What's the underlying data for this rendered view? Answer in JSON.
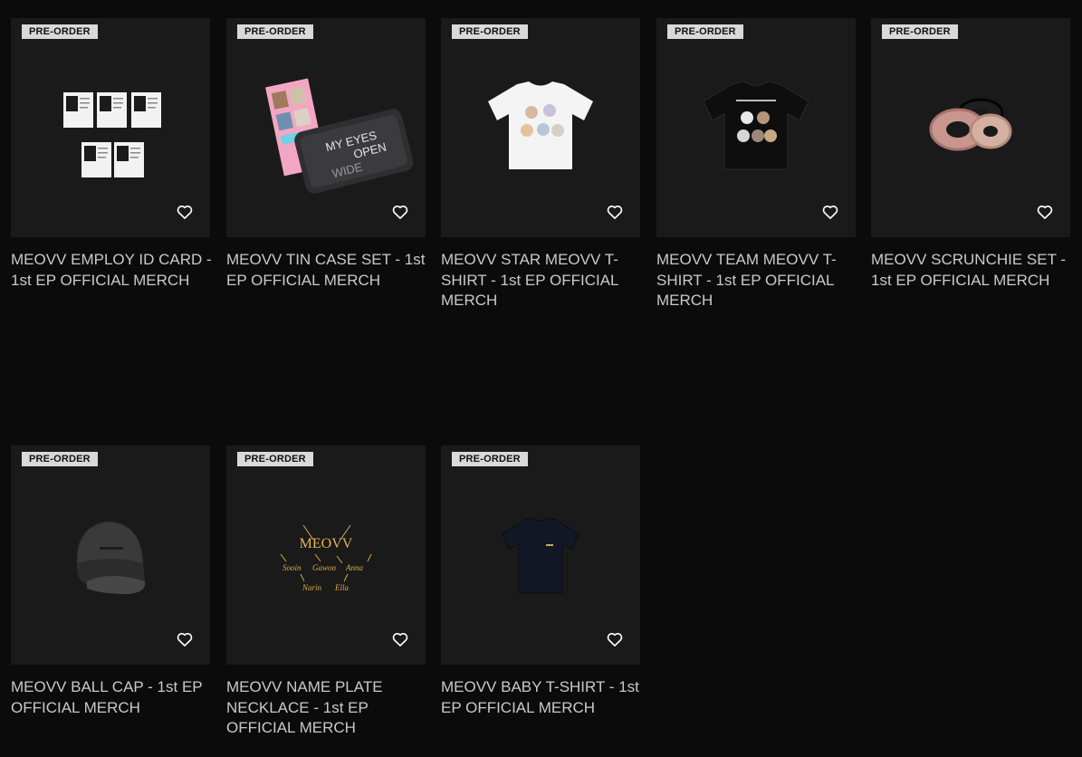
{
  "products": [
    {
      "badge": "PRE-ORDER",
      "title": "MEOVV EMPLOY ID CARD - 1st EP OFFICIAL MERCH",
      "image": "id-cards"
    },
    {
      "badge": "PRE-ORDER",
      "title": "MEOVV TIN CASE SET - 1st EP OFFICIAL MERCH",
      "image": "tin-case"
    },
    {
      "badge": "PRE-ORDER",
      "title": "MEOVV STAR MEOVV T-SHIRT - 1st EP OFFICIAL MERCH",
      "image": "white-tshirt"
    },
    {
      "badge": "PRE-ORDER",
      "title": "MEOVV TEAM MEOVV T-SHIRT - 1st EP OFFICIAL MERCH",
      "image": "black-tshirt"
    },
    {
      "badge": "PRE-ORDER",
      "title": "MEOVV SCRUNCHIE SET - 1st EP OFFICIAL MERCH",
      "image": "scrunchies"
    },
    {
      "badge": "PRE-ORDER",
      "title": "MEOVV BALL CAP - 1st EP OFFICIAL MERCH",
      "image": "ball-cap"
    },
    {
      "badge": "PRE-ORDER",
      "title": "MEOVV NAME PLATE NECKLACE - 1st EP OFFICIAL MERCH",
      "image": "necklace"
    },
    {
      "badge": "PRE-ORDER",
      "title": "MEOVV BABY T-SHIRT - 1st EP OFFICIAL MERCH",
      "image": "baby-tshirt"
    }
  ],
  "artwork_text": {
    "tin_case": [
      "MY EYES",
      "OPEN",
      "WIDE"
    ],
    "necklace_brand": "MEOVV",
    "necklace_names": [
      "Sooin",
      "Gawon",
      "Anna",
      "Narin",
      "Ella"
    ]
  },
  "icons": {
    "wishlist": "heart-outline-icon"
  },
  "colors": {
    "background": "#0b0b0b",
    "card": "#1a1a1a",
    "badge_bg": "#d9d9d9",
    "title_text": "#c9c9c9",
    "necklace_gold": "#d8a84a"
  }
}
